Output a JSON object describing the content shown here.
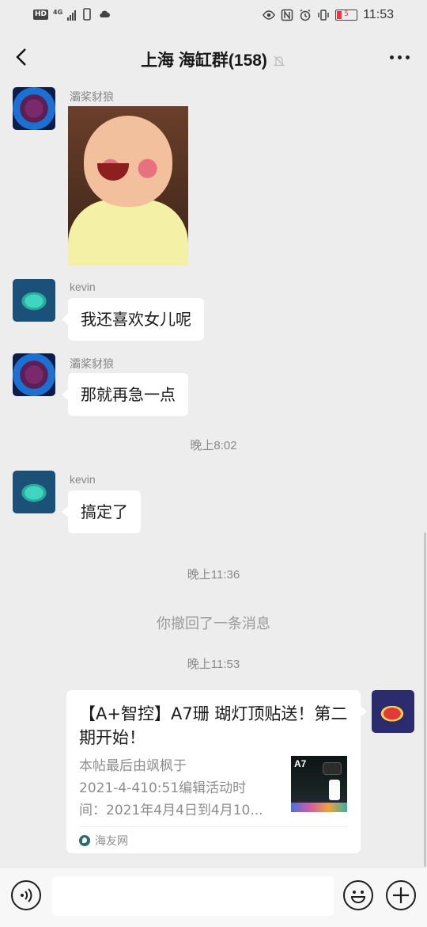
{
  "status_bar": {
    "hd_badge": "HD",
    "network": "4G",
    "battery_level": "5",
    "time": "11:53"
  },
  "header": {
    "title": "上海 海缸群(158)",
    "icons": [
      "back-arrow-icon",
      "mute-bell-icon",
      "more-dots-icon"
    ]
  },
  "messages": [
    {
      "type": "image",
      "sender": "灞桨豺狼",
      "avatar": "purple-coral"
    },
    {
      "type": "text",
      "sender": "kevin",
      "text": "我还喜欢女儿呢",
      "avatar": "green-coral"
    },
    {
      "type": "text",
      "sender": "灞桨豺狼",
      "text": "那就再急一点",
      "avatar": "purple-coral"
    },
    {
      "type": "time",
      "text": "晚上8:02"
    },
    {
      "type": "text",
      "sender": "kevin",
      "text": "搞定了",
      "avatar": "green-coral"
    },
    {
      "type": "time",
      "text": "晚上11:36"
    },
    {
      "type": "system",
      "text": "你撤回了一条消息"
    },
    {
      "type": "time",
      "text": "晚上11:53"
    },
    {
      "type": "link-card",
      "title": "【A+智控】A7珊 瑚灯顶贴送！第二期开始！",
      "desc": "本帖最后由飒枫于\n2021-4-410:51编辑活动时\n间：2021年4月4日到4月10...",
      "thumb_label": "A7",
      "source": "海友网",
      "avatar": "red-fish"
    }
  ],
  "input_bar": {
    "icons": [
      "voice-icon",
      "emoji-icon",
      "plus-icon"
    ],
    "value": ""
  },
  "colors": {
    "background": "#ededed",
    "bubble": "#ffffff",
    "time_text": "#8a8a8a"
  }
}
